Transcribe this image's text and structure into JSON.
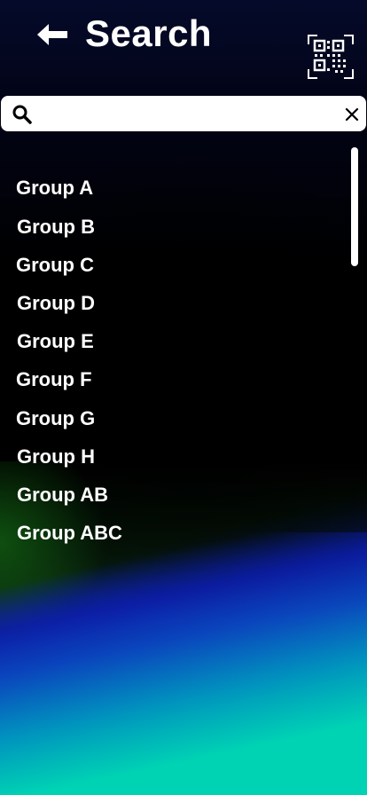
{
  "header": {
    "title": "Search",
    "back_icon": "arrow-left-icon",
    "qr_icon": "qr-scan-icon"
  },
  "search": {
    "value": "",
    "placeholder": "",
    "icon": "search-icon",
    "clear_icon": "close-icon"
  },
  "groups": [
    {
      "label": "Group A"
    },
    {
      "label": "Group B"
    },
    {
      "label": "Group C"
    },
    {
      "label": "Group D"
    },
    {
      "label": "Group E"
    },
    {
      "label": "Group F"
    },
    {
      "label": "Group G"
    },
    {
      "label": "Group H"
    },
    {
      "label": "Group AB"
    },
    {
      "label": "Group ABC"
    }
  ],
  "colors": {
    "text": "#ffffff",
    "search_bg": "#ffffff",
    "gradient_bottom": "#00d2b0",
    "gradient_blue": "#0a3fb0"
  }
}
